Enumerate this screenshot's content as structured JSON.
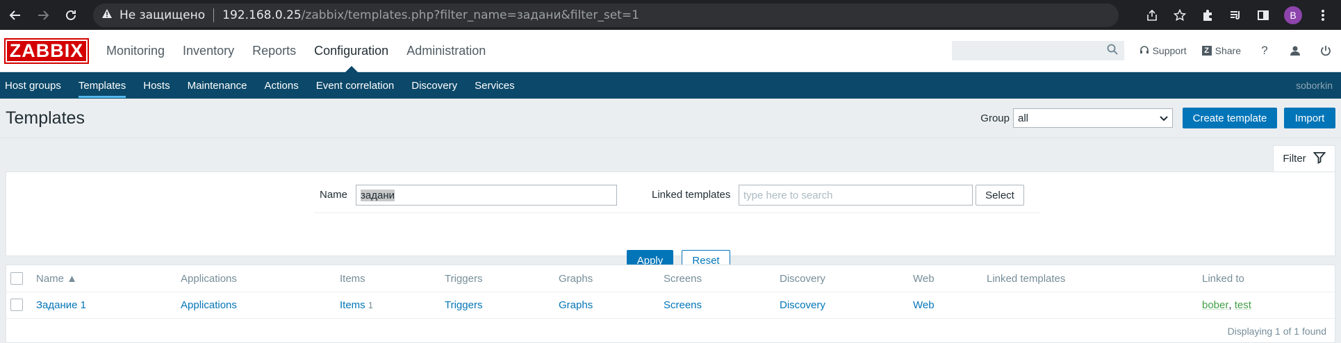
{
  "browser": {
    "security_label": "Не защищено",
    "url_host": "192.168.0.25",
    "url_path": "/zabbix/templates.php?filter_name=задани&filter_set=1",
    "profile_initial": "B"
  },
  "header": {
    "logo": "ZABBIX",
    "menu": [
      "Monitoring",
      "Inventory",
      "Reports",
      "Configuration",
      "Administration"
    ],
    "support": "Support",
    "share": "Share",
    "help": "?"
  },
  "subnav": {
    "items": [
      "Host groups",
      "Templates",
      "Hosts",
      "Maintenance",
      "Actions",
      "Event correlation",
      "Discovery",
      "Services"
    ],
    "user": "soborkin"
  },
  "page": {
    "title": "Templates",
    "group_label": "Group",
    "group_value": "all",
    "create_button": "Create template",
    "import_button": "Import"
  },
  "filter": {
    "tab_label": "Filter",
    "name_label": "Name",
    "name_value": "задани",
    "linked_label": "Linked templates",
    "linked_placeholder": "type here to search",
    "select_button": "Select",
    "apply_button": "Apply",
    "reset_button": "Reset"
  },
  "table": {
    "columns": [
      "Name ▲",
      "Applications",
      "Items",
      "Triggers",
      "Graphs",
      "Screens",
      "Discovery",
      "Web",
      "Linked templates",
      "Linked to"
    ],
    "rows": [
      {
        "name": "Задание 1",
        "applications": "Applications",
        "items": "Items",
        "items_count": "1",
        "triggers": "Triggers",
        "graphs": "Graphs",
        "screens": "Screens",
        "discovery": "Discovery",
        "web": "Web",
        "linked_templates": "",
        "linked_to": [
          "bober",
          "test"
        ]
      }
    ],
    "footer": "Displaying 1 of 1 found"
  },
  "colors": {
    "brand_red": "#d40000",
    "subnav_bg": "#0b4869",
    "primary_blue": "#0275b8",
    "linked_green": "#429e47"
  }
}
